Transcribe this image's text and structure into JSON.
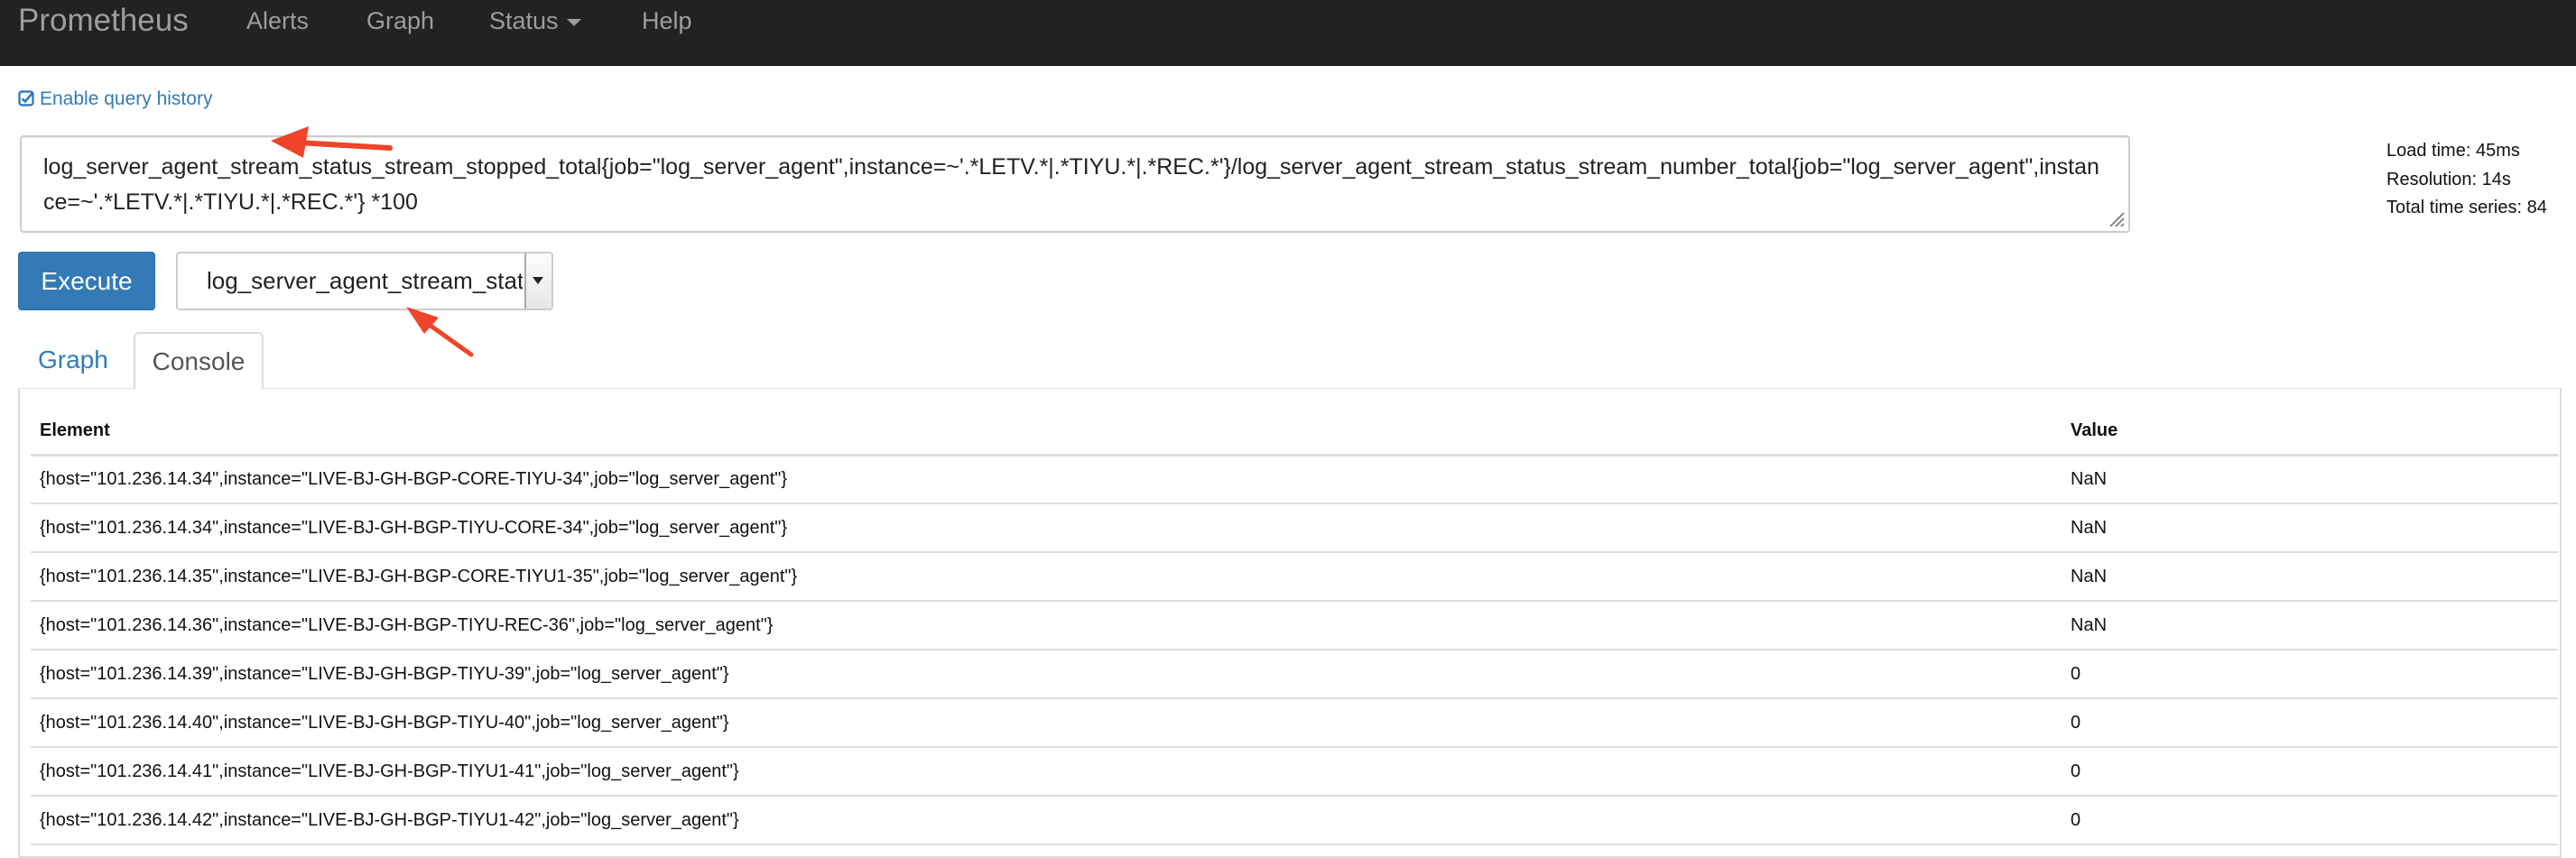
{
  "navbar": {
    "brand": "Prometheus",
    "links": [
      "Alerts",
      "Graph",
      "Status",
      "Help"
    ]
  },
  "history": {
    "icon": "check-square-icon",
    "label": "Enable query history"
  },
  "expression": {
    "value": "log_server_agent_stream_status_stream_stopped_total{job=\"log_server_agent\",instance=~'.*LETV.*|.*TIYU.*|.*REC.*'}/log_server_agent_stream_status_stream_number_total{job=\"log_server_agent\",instance=~'.*LETV.*|.*TIYU.*|.*REC.*'} *100"
  },
  "stats": {
    "load_time": "Load time: 45ms",
    "resolution": "Resolution: 14s",
    "total_series": "Total time series: 84"
  },
  "controls": {
    "execute_label": "Execute",
    "metric_select_value": "log_server_agent_stream_status_stream_stopped_total"
  },
  "tabs": {
    "graph": "Graph",
    "console": "Console",
    "active": "Console"
  },
  "table": {
    "headers": {
      "element": "Element",
      "value": "Value"
    },
    "rows": [
      {
        "element": "{host=\"101.236.14.34\",instance=\"LIVE-BJ-GH-BGP-CORE-TIYU-34\",job=\"log_server_agent\"}",
        "value": "NaN"
      },
      {
        "element": "{host=\"101.236.14.34\",instance=\"LIVE-BJ-GH-BGP-TIYU-CORE-34\",job=\"log_server_agent\"}",
        "value": "NaN"
      },
      {
        "element": "{host=\"101.236.14.35\",instance=\"LIVE-BJ-GH-BGP-CORE-TIYU1-35\",job=\"log_server_agent\"}",
        "value": "NaN"
      },
      {
        "element": "{host=\"101.236.14.36\",instance=\"LIVE-BJ-GH-BGP-TIYU-REC-36\",job=\"log_server_agent\"}",
        "value": "NaN"
      },
      {
        "element": "{host=\"101.236.14.39\",instance=\"LIVE-BJ-GH-BGP-TIYU-39\",job=\"log_server_agent\"}",
        "value": "0"
      },
      {
        "element": "{host=\"101.236.14.40\",instance=\"LIVE-BJ-GH-BGP-TIYU-40\",job=\"log_server_agent\"}",
        "value": "0"
      },
      {
        "element": "{host=\"101.236.14.41\",instance=\"LIVE-BJ-GH-BGP-TIYU1-41\",job=\"log_server_agent\"}",
        "value": "0"
      },
      {
        "element": "{host=\"101.236.14.42\",instance=\"LIVE-BJ-GH-BGP-TIYU1-42\",job=\"log_server_agent\"}",
        "value": "0"
      }
    ]
  },
  "colors": {
    "navbar_bg": "#222222",
    "link": "#337ab7",
    "annotation_arrow": "#f0432a"
  }
}
